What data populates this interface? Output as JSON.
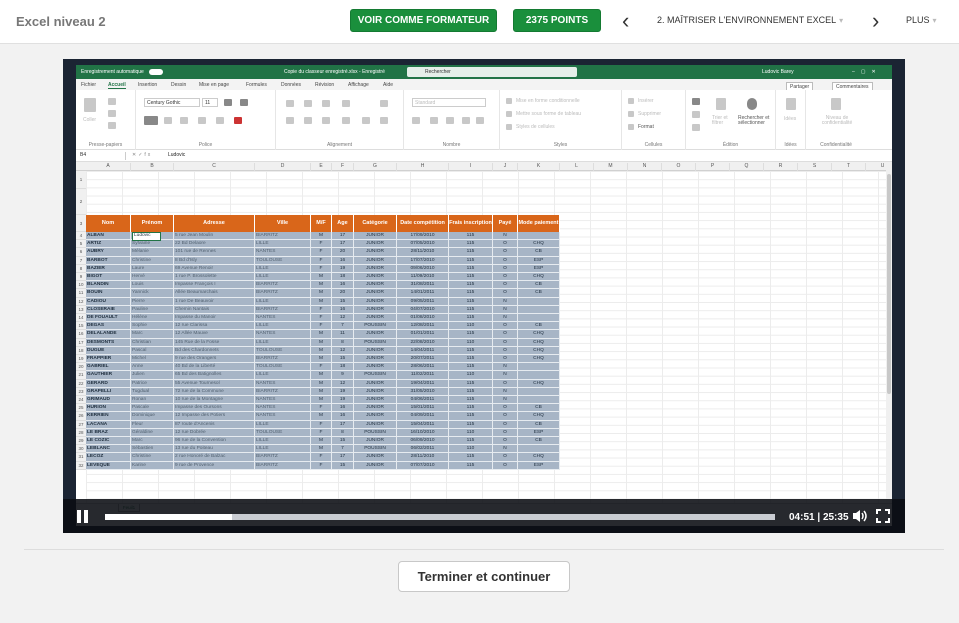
{
  "topbar": {
    "course_title": "Excel niveau 2",
    "trainer_button": "VOIR COMME FORMATEUR",
    "points_button": "2375 POINTS",
    "chapter": "2. MAÎTRISER L'ENVIRONNEMENT EXCEL",
    "more": "PLUS"
  },
  "colors": {
    "accent_green": "#1a8f3c",
    "excel_green": "#217346",
    "header_orange": "#d9661a",
    "row_blue": "#a7b5c6"
  },
  "icons": [
    "chevron-left-icon",
    "chevron-right-icon",
    "chevron-down-icon",
    "pause-icon",
    "volume-icon",
    "fullscreen-icon"
  ],
  "excel": {
    "autosave": "Enregistrement automatique",
    "doc_title": "Copie du classeur enregistré.xlsx  -  Enregistré",
    "search": "Rechercher",
    "user": "Ludovic Barey",
    "tabs": [
      "Fichier",
      "Accueil",
      "Insertion",
      "Dessin",
      "Mise en page",
      "Formules",
      "Données",
      "Révision",
      "Affichage",
      "Aide"
    ],
    "share": "Partager",
    "comments": "Commentaires",
    "ribbon": {
      "paste": "Coller",
      "font_name": "Century Gothic",
      "font_size": "11",
      "number_format": "Standard",
      "cond_format": "Mise en forme conditionnelle",
      "table_format": "Mettre sous forme de tableau",
      "cell_styles": "Styles de cellules",
      "insert": "Insérer",
      "delete": "Supprimer",
      "format": "Format",
      "sort": "Trier et filtrer",
      "find": "Rechercher et sélectionner",
      "ideas": "Idées",
      "sensitivity": "Niveau de confidentialité",
      "groups": [
        "Presse-papiers",
        "Police",
        "Alignement",
        "Nombre",
        "Styles",
        "Cellules",
        "Édition",
        "Idées",
        "Confidentialité"
      ]
    },
    "name_box": "B4",
    "formula_value": "Ludovic",
    "columns": [
      "A",
      "B",
      "C",
      "D",
      "E",
      "F",
      "G",
      "H",
      "I",
      "J",
      "K",
      "L",
      "M",
      "N",
      "O",
      "P",
      "Q",
      "R",
      "S",
      "T",
      "U"
    ],
    "headers": [
      "Nom",
      "Prénom",
      "Adresse",
      "Ville",
      "M/F",
      "Age",
      "Catégorie",
      "Date compétition",
      "Frais inscription",
      "Payé",
      "Mode paiement"
    ],
    "rows": [
      [
        "ALBAN",
        "Ludovic",
        "5 rue Jean Moulin",
        "BIARRITZ",
        "M",
        "17",
        "JUNIOR",
        "17/09/2010",
        "115",
        "N",
        ""
      ],
      [
        "ARTIZ",
        "Sylvaine",
        "22 Bd Delaore",
        "LILLE",
        "F",
        "17",
        "JUNIOR",
        "07/05/2010",
        "115",
        "O",
        "CHQ"
      ],
      [
        "AUBRY",
        "Mélanie",
        "101 rue de Rennes",
        "NANTES",
        "F",
        "20",
        "JUNIOR",
        "28/11/2010",
        "115",
        "O",
        "CB"
      ],
      [
        "BARBOT",
        "Christine",
        "8 Bd d'Isly",
        "TOULOUSE",
        "F",
        "16",
        "JUNIOR",
        "17/07/2010",
        "115",
        "O",
        "ESP"
      ],
      [
        "BAZIER",
        "Laure",
        "69 Avenue Renoir",
        "LILLE",
        "F",
        "19",
        "JUNIOR",
        "09/06/2010",
        "115",
        "O",
        "ESP"
      ],
      [
        "BIGOT",
        "Hervé",
        "1 rue P. Brossolette",
        "LILLE",
        "M",
        "18",
        "JUNIOR",
        "11/09/2010",
        "115",
        "O",
        "CHQ"
      ],
      [
        "BLANDIN",
        "Louis",
        "Impasse François I",
        "BIARRITZ",
        "M",
        "16",
        "JUNIOR",
        "31/08/2011",
        "115",
        "O",
        "CB"
      ],
      [
        "BOUIN",
        "Yannick",
        "Allée Beaumarchais",
        "BIARRITZ",
        "M",
        "20",
        "JUNIOR",
        "14/01/2011",
        "115",
        "O",
        "CB"
      ],
      [
        "CADIOU",
        "Pierre",
        "1 rue De Beauvoir",
        "LILLE",
        "M",
        "15",
        "JUNIOR",
        "09/05/2011",
        "115",
        "N",
        ""
      ],
      [
        "CLOSERAIE",
        "Pauline",
        "Chemin Nantais",
        "BIARRITZ",
        "F",
        "16",
        "JUNIOR",
        "04/07/2010",
        "115",
        "N",
        ""
      ],
      [
        "DE FOUAULT",
        "Hélène",
        "Impasse du Manoir",
        "NANTES",
        "F",
        "12",
        "JUNIOR",
        "01/08/2010",
        "115",
        "N",
        ""
      ],
      [
        "DEGAS",
        "Sophie",
        "12 rue Clarissa",
        "LILLE",
        "F",
        "7",
        "POUSSIN",
        "12/08/2011",
        "110",
        "O",
        "CB"
      ],
      [
        "DELALANDE",
        "Marc",
        "12 Allée Mauve",
        "NANTES",
        "M",
        "11",
        "JUNIOR",
        "01/01/2011",
        "115",
        "O",
        "CHQ"
      ],
      [
        "DESMONTS",
        "Christian",
        "145 Rue de la Fosse",
        "LILLE",
        "M",
        "8",
        "POUSSIN",
        "22/08/2010",
        "110",
        "O",
        "CHQ"
      ],
      [
        "DUGUE",
        "Pascal",
        "Bd des Chardonnets",
        "TOULOUSE",
        "M",
        "12",
        "JUNIOR",
        "14/04/2011",
        "115",
        "O",
        "CHQ"
      ],
      [
        "FRAPPIER",
        "Michel",
        "9 rue des Orangers",
        "BIARRITZ",
        "M",
        "15",
        "JUNIOR",
        "20/07/2011",
        "115",
        "O",
        "CHQ"
      ],
      [
        "GABRIEL",
        "Anne",
        "40 Bd de la Liberté",
        "TOULOUSE",
        "F",
        "18",
        "JUNIOR",
        "28/06/2011",
        "115",
        "N",
        ""
      ],
      [
        "GAUTHIER",
        "Julien",
        "65 Bd des Batignolles",
        "LILLE",
        "M",
        "9",
        "POUSSIN",
        "11/02/2011",
        "110",
        "N",
        ""
      ],
      [
        "GERARD",
        "Patrice",
        "55 Avenue Tournesol",
        "NANTES",
        "M",
        "12",
        "JUNIOR",
        "19/04/2011",
        "115",
        "O",
        "CHQ"
      ],
      [
        "GRAPELLI",
        "Tugdual",
        "72 rue de la Commune",
        "BIARRITZ",
        "M",
        "19",
        "JUNIOR",
        "31/05/2010",
        "115",
        "N",
        ""
      ],
      [
        "GRIMAUD",
        "Ronan",
        "10 rue de la Montagne",
        "NANTES",
        "M",
        "19",
        "JUNIOR",
        "04/06/2011",
        "115",
        "N",
        ""
      ],
      [
        "HURION",
        "Pascale",
        "Impasse des Oursons",
        "NANTES",
        "F",
        "16",
        "JUNIOR",
        "15/01/2011",
        "115",
        "O",
        "CB"
      ],
      [
        "KERRIEN",
        "Dominique",
        "12 Impasse des Potiers",
        "NANTES",
        "M",
        "16",
        "JUNIOR",
        "04/09/2011",
        "115",
        "O",
        "CHQ"
      ],
      [
        "LACANA",
        "Fleur",
        "87 route d'Ancenis",
        "LILLE",
        "F",
        "17",
        "JUNIOR",
        "15/04/2011",
        "115",
        "O",
        "CB"
      ],
      [
        "LE BRAZ",
        "Géraldine",
        "12 rue Dobrée",
        "TOULOUSE",
        "F",
        "8",
        "POUSSIN",
        "16/10/2010",
        "110",
        "O",
        "ESP"
      ],
      [
        "LE COZIC",
        "Marc",
        "96 rue de la Convention",
        "LILLE",
        "M",
        "15",
        "JUNIOR",
        "06/09/2010",
        "115",
        "O",
        "CB"
      ],
      [
        "LEBLANC",
        "Sébastien",
        "13 rue du Poiteau",
        "LILLE",
        "M",
        "7",
        "POUSSIN",
        "06/02/2011",
        "110",
        "N",
        ""
      ],
      [
        "LECOZ",
        "Christine",
        "2 rue Honoré de Balzac",
        "BIARRITZ",
        "F",
        "17",
        "JUNIOR",
        "28/11/2010",
        "115",
        "O",
        "CHQ"
      ],
      [
        "LEVEQUE",
        "Karine",
        "9 rue de Provence",
        "BIARRITZ",
        "F",
        "15",
        "JUNIOR",
        "07/07/2010",
        "115",
        "O",
        "ESP"
      ]
    ],
    "sheet_tab": "Feuil1"
  },
  "player": {
    "current_time": "04:51",
    "separator": " | ",
    "duration": "25:35",
    "progress": 0.19
  },
  "footer": {
    "continue_button": "Terminer et continuer"
  }
}
